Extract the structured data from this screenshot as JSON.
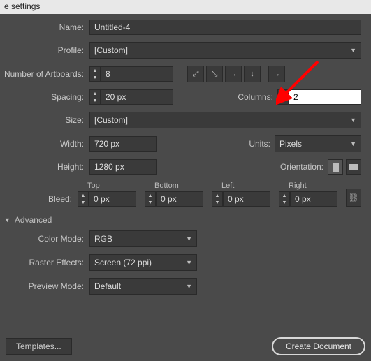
{
  "titlebar": "e settings",
  "labels": {
    "name": "Name:",
    "profile": "Profile:",
    "numArtboards": "Number of Artboards:",
    "spacing": "Spacing:",
    "columns": "Columns:",
    "size": "Size:",
    "width": "Width:",
    "height": "Height:",
    "units": "Units:",
    "orientation": "Orientation:",
    "bleed": "Bleed:",
    "top": "Top",
    "bottom": "Bottom",
    "left": "Left",
    "right": "Right",
    "advanced": "Advanced",
    "colorMode": "Color Mode:",
    "rasterEffects": "Raster Effects:",
    "previewMode": "Preview Mode:"
  },
  "values": {
    "name": "Untitled-4",
    "profile": "[Custom]",
    "numArtboards": "8",
    "spacing": "20 px",
    "columns": "2",
    "size": "[Custom]",
    "width": "720 px",
    "height": "1280 px",
    "units": "Pixels",
    "bleedTop": "0 px",
    "bleedBottom": "0 px",
    "bleedLeft": "0 px",
    "bleedRight": "0 px",
    "colorMode": "RGB",
    "rasterEffects": "Screen (72 ppi)",
    "previewMode": "Default"
  },
  "buttons": {
    "templates": "Templates...",
    "createDocument": "Create Document"
  },
  "icons": {
    "gridZ": "⤢",
    "gridN": "⤡",
    "arrowR": "→",
    "arrowD": "↓",
    "arrowRR": "→"
  }
}
